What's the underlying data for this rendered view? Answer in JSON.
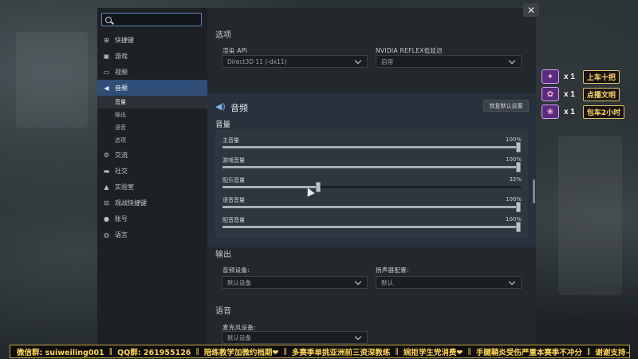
{
  "sidebar": {
    "search_placeholder": "",
    "items": [
      {
        "label": "快捷键",
        "icon": "sitemap-icon"
      },
      {
        "label": "游戏",
        "icon": "game-icon"
      },
      {
        "label": "视频",
        "icon": "monitor-icon"
      },
      {
        "label": "音频",
        "icon": "speaker-icon",
        "active": true
      },
      {
        "label": "交流",
        "icon": "gear-icon"
      },
      {
        "label": "社交",
        "icon": "chat-icon"
      },
      {
        "label": "实验室",
        "icon": "flask-icon"
      },
      {
        "label": "观战快捷键",
        "icon": "grid-icon"
      },
      {
        "label": "账号",
        "icon": "user-icon"
      },
      {
        "label": "语言",
        "icon": "globe-icon"
      }
    ],
    "audio_subitems": [
      "音量",
      "输出",
      "语音",
      "选项"
    ]
  },
  "options": {
    "section_title": "选项",
    "render_api_label": "渲染 API",
    "render_api_value": "Direct3D 11 (-dx11)",
    "reflex_label": "NVIDIA REFLEX低延迟",
    "reflex_value": "启用"
  },
  "audio": {
    "title": "音频",
    "reset_label": "恢复默认设置",
    "volume_label": "音量",
    "sliders": [
      {
        "name": "主音量",
        "value": "100%",
        "level": 1.0
      },
      {
        "name": "游戏音量",
        "value": "100%",
        "level": 1.0
      },
      {
        "name": "配乐音量",
        "value": "32%",
        "level": 0.32
      },
      {
        "name": "语音音量",
        "value": "100%",
        "level": 1.0
      },
      {
        "name": "配音音量",
        "value": "100%",
        "level": 1.0
      }
    ]
  },
  "output": {
    "section_title": "输出",
    "device_label": "音频设备:",
    "device_value": "默认设备",
    "speaker_label": "扬声器配置:",
    "speaker_value": "默认"
  },
  "voice": {
    "section_title": "语音",
    "mic_label": "麦克风设备:",
    "mic_value": "默认设备"
  },
  "gifts": [
    {
      "count": "x 1",
      "name": "上车十把"
    },
    {
      "count": "x 1",
      "name": "点播文明"
    },
    {
      "count": "x 1",
      "name": "包车2小时"
    }
  ],
  "ticker": [
    "微信群: suiweiling001",
    "QQ群: 261955126",
    "陪练教学加微约档期❤",
    "多赛季单挑亚洲前三资深教练",
    "婉拒学生党消费❤",
    "手腱鞘炎受伤严重本赛季不冲分",
    "谢谢支持~❤"
  ],
  "close_label": "✕"
}
